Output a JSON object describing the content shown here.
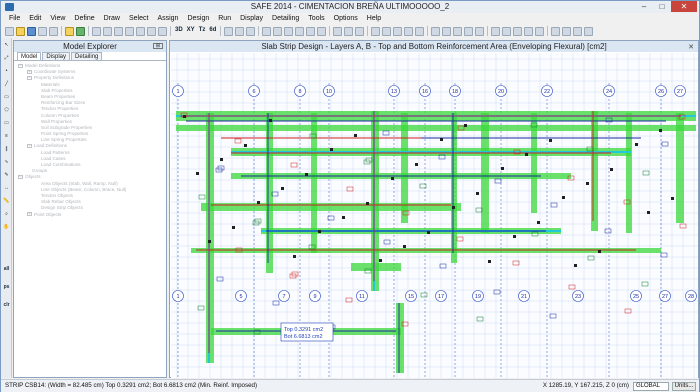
{
  "window": {
    "title": "SAFE 2014 - CIMENTACION BREÑA ULTIMOOOOO_2",
    "min_label": "–",
    "max_label": "□",
    "close_label": "✕"
  },
  "menu": [
    "File",
    "Edit",
    "View",
    "Define",
    "Draw",
    "Select",
    "Assign",
    "Design",
    "Run",
    "Display",
    "Detailing",
    "Tools",
    "Options",
    "Help"
  ],
  "toolbar": {
    "text_buttons": [
      "3D",
      "XY",
      "Tz",
      "6d"
    ]
  },
  "left_toolbar": {
    "labels": [
      "all",
      "ps",
      "clr"
    ]
  },
  "explorer": {
    "title": "Model Explorer",
    "pin_label": "⊞",
    "tabs": [
      "Model",
      "Display",
      "Detailing"
    ],
    "tree": [
      {
        "label": "Model Definitions",
        "level": 0,
        "expander": "−"
      },
      {
        "label": "Coordinate Systems",
        "level": 1,
        "expander": "+"
      },
      {
        "label": "Property Definitions",
        "level": 1,
        "expander": "−"
      },
      {
        "label": "Materials",
        "level": 2,
        "expander": ""
      },
      {
        "label": "Slab Properties",
        "level": 2,
        "expander": ""
      },
      {
        "label": "Beam Properties",
        "level": 2,
        "expander": ""
      },
      {
        "label": "Reinforcing Bar Sizes",
        "level": 2,
        "expander": ""
      },
      {
        "label": "Tendon Properties",
        "level": 2,
        "expander": ""
      },
      {
        "label": "Column Properties",
        "level": 2,
        "expander": ""
      },
      {
        "label": "Wall Properties",
        "level": 2,
        "expander": ""
      },
      {
        "label": "Soil Subgrade Properties",
        "level": 2,
        "expander": ""
      },
      {
        "label": "Point Spring Properties",
        "level": 2,
        "expander": ""
      },
      {
        "label": "Line Spring Properties",
        "level": 2,
        "expander": ""
      },
      {
        "label": "Load Definitions",
        "level": 1,
        "expander": "−"
      },
      {
        "label": "Load Patterns",
        "level": 2,
        "expander": ""
      },
      {
        "label": "Load Cases",
        "level": 2,
        "expander": ""
      },
      {
        "label": "Load Combinations",
        "level": 2,
        "expander": ""
      },
      {
        "label": "Groups",
        "level": 1,
        "expander": ""
      },
      {
        "label": "Objects",
        "level": 0,
        "expander": "−"
      },
      {
        "label": "Area Objects (Slab, Wall, Ramp, Null)",
        "level": 2,
        "expander": ""
      },
      {
        "label": "Line Objects (Beam, Column, Brace, Null)",
        "level": 2,
        "expander": ""
      },
      {
        "label": "Tendon Objects",
        "level": 2,
        "expander": ""
      },
      {
        "label": "Slab Rebar Objects",
        "level": 2,
        "expander": ""
      },
      {
        "label": "Design Strip Objects",
        "level": 2,
        "expander": ""
      },
      {
        "label": "Point Objects",
        "level": 1,
        "expander": "+"
      }
    ]
  },
  "canvas": {
    "title": "Slab Strip Design - Layers A, B - Top and Bottom Reinforcement Area (Enveloping Flexural) [cm2]",
    "close_label": "✕",
    "top_grid_labels": [
      "1",
      "6",
      "8",
      "10",
      "13",
      "16",
      "18",
      "20",
      "22",
      "24",
      "26",
      "27"
    ],
    "bottom_grid_labels": [
      "1",
      "5",
      "7",
      "9",
      "11",
      "15",
      "17",
      "19",
      "21",
      "23",
      "25",
      "27",
      "28"
    ],
    "tooltip_top": "Top 0.3291 cm2",
    "tooltip_bot": "Bot 6.6813 cm2"
  },
  "status": {
    "left": "STRIP CSB14:  (Width = 82.485 cm)  Top 0.3291 cm2; Bot 6.6813 cm2  (Min. Reinf. Imposed)",
    "coords": "X 1285.19,  Y 167.215,  Z 0  (cm)",
    "combo": "GLOBAL",
    "units": "Units..."
  }
}
